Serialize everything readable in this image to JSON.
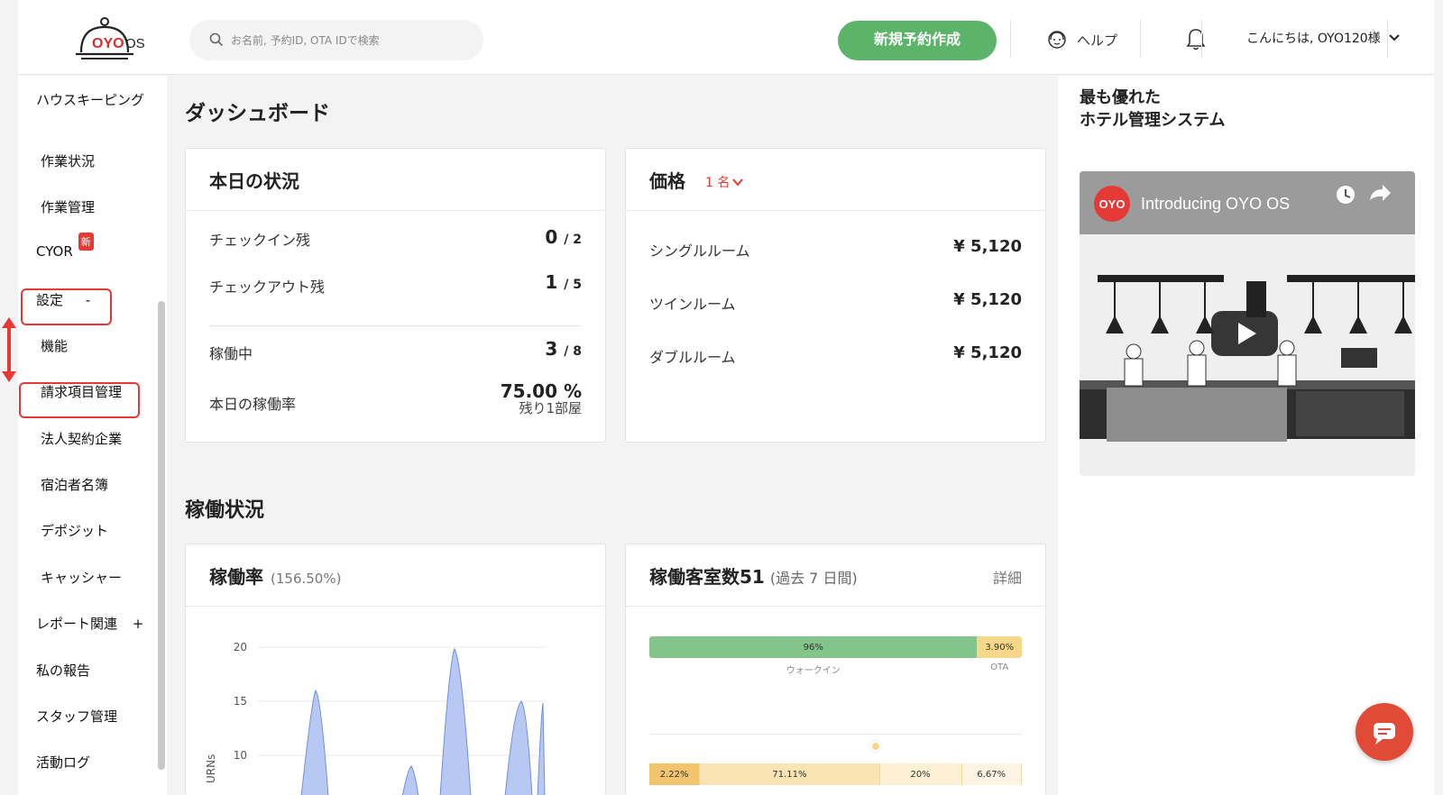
{
  "header": {
    "logo_text": "OYO",
    "logo_os": "OS",
    "search_placeholder": "お名前, 予約ID, OTA IDで検索",
    "new_booking_label": "新規予約作成",
    "help_label": "ヘルプ",
    "greeting": "こんにちは, OYO120様"
  },
  "sidebar": {
    "items": [
      {
        "label": "ハウスキーピング"
      },
      {
        "label": "作業状況"
      },
      {
        "label": "作業管理"
      },
      {
        "label": "CYOR",
        "badge": "新"
      },
      {
        "label": "設定",
        "toggle": "-"
      },
      {
        "label": "機能"
      },
      {
        "label": "請求項目管理"
      },
      {
        "label": "法人契約企業"
      },
      {
        "label": "宿泊者名簿"
      },
      {
        "label": "デポジット"
      },
      {
        "label": "キャッシャー"
      },
      {
        "label": "レポート関連",
        "toggle": "+"
      },
      {
        "label": "私の報告"
      },
      {
        "label": "スタッフ管理"
      },
      {
        "label": "活動ログ"
      }
    ]
  },
  "main": {
    "title": "ダッシュボード",
    "today": {
      "title": "本日の状況",
      "rows": [
        {
          "label": "チェックイン残",
          "value": "0",
          "total": "/ 2"
        },
        {
          "label": "チェックアウト残",
          "value": "1",
          "total": "/ 5"
        },
        {
          "label": "稼働中",
          "value": "3",
          "total": "/ 8"
        },
        {
          "label": "本日の稼働率",
          "value": "75.00 %",
          "sub": "残り1部屋"
        }
      ]
    },
    "price": {
      "title": "価格",
      "guests": "1 名",
      "rows": [
        {
          "label": "シングルルーム",
          "value": "¥ 5,120"
        },
        {
          "label": "ツインルーム",
          "value": "¥ 5,120"
        },
        {
          "label": "ダブルルーム",
          "value": "¥ 5,120"
        }
      ]
    },
    "occupancy_title": "稼働状況",
    "occ_rate": {
      "title": "稼働率",
      "pct": "(156.50%)",
      "y_axis_label": "URNs",
      "y_ticks": [
        "20",
        "15",
        "10"
      ]
    },
    "occ_rooms": {
      "title": "稼働客室数51",
      "period": "(過去 7 日間)",
      "detail_link": "詳細",
      "bar1": [
        {
          "label": "96%",
          "caption": "ウォークイン",
          "share": 0.88,
          "color": "#83c48b"
        },
        {
          "label": "3.90%",
          "caption": "OTA",
          "share": 0.12,
          "color": "#f7d789"
        }
      ],
      "bar2": [
        {
          "label": "2.22%",
          "share": 0.135,
          "color": "#f2c46e"
        },
        {
          "label": "71.11%",
          "share": 0.485,
          "color": "#fbe4b4"
        },
        {
          "label": "20%",
          "share": 0.22,
          "color": "#fdf0d3"
        },
        {
          "label": "6.67%",
          "share": 0.16,
          "color": "#fdf4e3"
        }
      ]
    }
  },
  "right_panel": {
    "promo_line1": "最も優れた",
    "promo_line2": "ホテル管理システム",
    "video_title": "Introducing OYO OS",
    "video_logo": "OYO"
  }
}
